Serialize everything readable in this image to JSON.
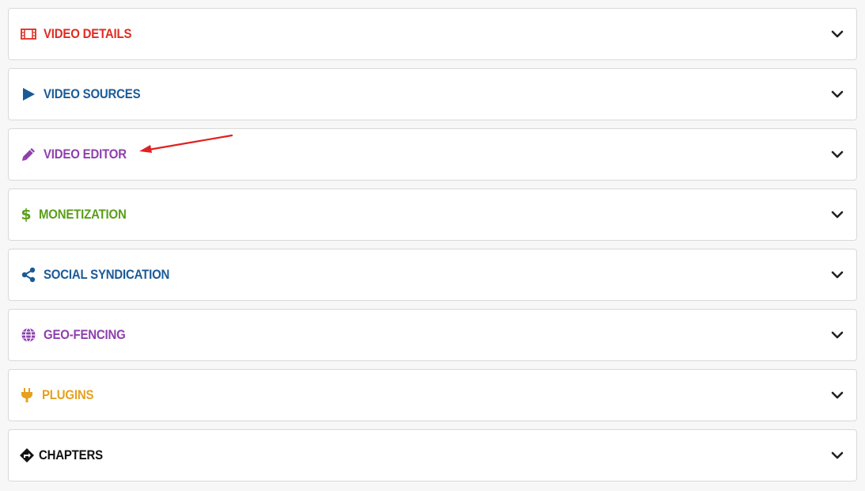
{
  "panels": [
    {
      "label": "VIDEO DETAILS",
      "icon": "film-icon",
      "color": "#e02b20"
    },
    {
      "label": "VIDEO SOURCES",
      "icon": "play-icon",
      "color": "#1a5a96"
    },
    {
      "label": "VIDEO EDITOR",
      "icon": "pencil-icon",
      "color": "#8e3fad"
    },
    {
      "label": "MONETIZATION",
      "icon": "dollar-icon",
      "color": "#5a9e1a"
    },
    {
      "label": "SOCIAL SYNDICATION",
      "icon": "share-icon",
      "color": "#1a5a96"
    },
    {
      "label": "GEO-FENCING",
      "icon": "globe-icon",
      "color": "#8e3fad"
    },
    {
      "label": "PLUGINS",
      "icon": "plug-icon",
      "color": "#e6a01e"
    },
    {
      "label": "CHAPTERS",
      "icon": "signpost-icon",
      "color": "#111111"
    }
  ],
  "chevron_icon": "chevron-down-icon",
  "annotation": {
    "color": "#e02020",
    "icon": "red-arrow-annotation"
  }
}
